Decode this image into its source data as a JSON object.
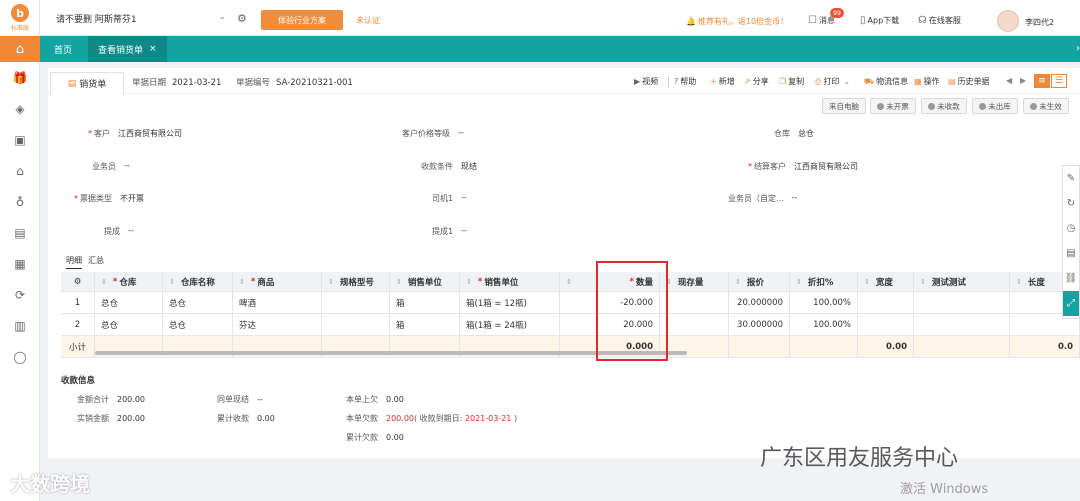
{
  "app": {
    "logo_text": "标准版",
    "account_name": "请不要删 阿斯蒂芬1",
    "plan_button": "体验行业方案",
    "unverified": "未认证",
    "recommend_text": "推荐有礼，返10倍金币！",
    "message_label": "消息",
    "message_badge": "99",
    "app_download": "App下载",
    "online_service": "在线客服",
    "username": "李四代2"
  },
  "tabs": [
    {
      "label": "首页"
    },
    {
      "label": "查看销货单",
      "close": "×"
    }
  ],
  "doc": {
    "tab_label": "销货单",
    "date_label": "单据日期",
    "date_value": "2021-03-21",
    "no_label": "单据编号",
    "no_value": "SA-20210321-001"
  },
  "toolbar": {
    "video": "视频",
    "help": "帮助",
    "add": "新增",
    "share": "分享",
    "copy": "复制",
    "print": "打印",
    "logistics": "物流信息",
    "operate": "操作",
    "history": "历史单据"
  },
  "status_badges": {
    "source": "来自电脑",
    "invoice": "未开票",
    "receipt": "未收款",
    "outbound": "未出库",
    "effective": "未生效"
  },
  "form": {
    "customer_label": "客户",
    "customer_value": "江西商贸有限公司",
    "price_level_label": "客户价格等级",
    "price_level_value": "--",
    "warehouse_label": "仓库",
    "warehouse_value": "总仓",
    "salesman_label": "业务员",
    "salesman_value": "--",
    "pay_terms_label": "收款条件",
    "pay_terms_value": "现结",
    "settle_customer_label": "结算客户",
    "settle_customer_value": "江西商贸有限公司",
    "invoice_type_label": "票据类型",
    "invoice_type_value": "不开票",
    "driver_label": "司机1",
    "driver_value": "--",
    "salesman_custom_label": "业务员（自定...",
    "salesman_custom_value": "--",
    "commission_label": "提成",
    "commission_value": "--",
    "commission1_label": "提成1",
    "commission1_value": "--"
  },
  "sub_tabs": [
    "明细",
    "汇总"
  ],
  "table": {
    "headers": {
      "warehouse": "仓库",
      "warehouse_name": "仓库名称",
      "product": "商品",
      "spec": "规格型号",
      "sale_unit": "销售单位",
      "sale_unit2": "销售单位",
      "qty": "数量",
      "stock": "现存量",
      "price": "报价",
      "discount": "折扣%",
      "width": "宽度",
      "test": "测试测试",
      "length": "长度"
    },
    "rows": [
      {
        "no": "1",
        "warehouse": "总仓",
        "warehouse_name": "总仓",
        "product": "啤酒",
        "unit": "箱",
        "unit2": "箱(1箱 = 12瓶)",
        "qty": "-20.000",
        "price": "20.000000",
        "discount": "100.00%"
      },
      {
        "no": "2",
        "warehouse": "总仓",
        "warehouse_name": "总仓",
        "product": "芬达",
        "unit": "箱",
        "unit2": "箱(1箱 = 24瓶)",
        "qty": "20.000",
        "price": "30.000000",
        "discount": "100.00%"
      }
    ],
    "total_label": "小计",
    "total_qty": "0.000",
    "total_width": "0.00",
    "total_length": "0.0"
  },
  "payment": {
    "title": "收款信息",
    "amount_total_label": "金额合计",
    "amount_total_value": "200.00",
    "actual_sales_label": "实销金额",
    "actual_sales_value": "200.00",
    "same_settle_label": "同单现结",
    "same_settle_value": "--",
    "accum_receipt_label": "累计收款",
    "accum_receipt_value": "0.00",
    "prev_owed_label": "本单上欠",
    "prev_owed_value": "0.00",
    "owed_label": "本单欠款",
    "owed_value": "200.00",
    "due_text": "( 收款到期日: ",
    "due_date": "2021-03-21",
    "due_close": " )",
    "accum_owed_label": "累计欠款",
    "accum_owed_value": "0.00"
  },
  "watermarks": {
    "left": "大数跨境",
    "right": "广东区用友服务中心",
    "windows": "激活 Windows"
  },
  "colors": {
    "accent": "#f0883a",
    "teal": "#14a3a1",
    "required": "#e02020"
  }
}
